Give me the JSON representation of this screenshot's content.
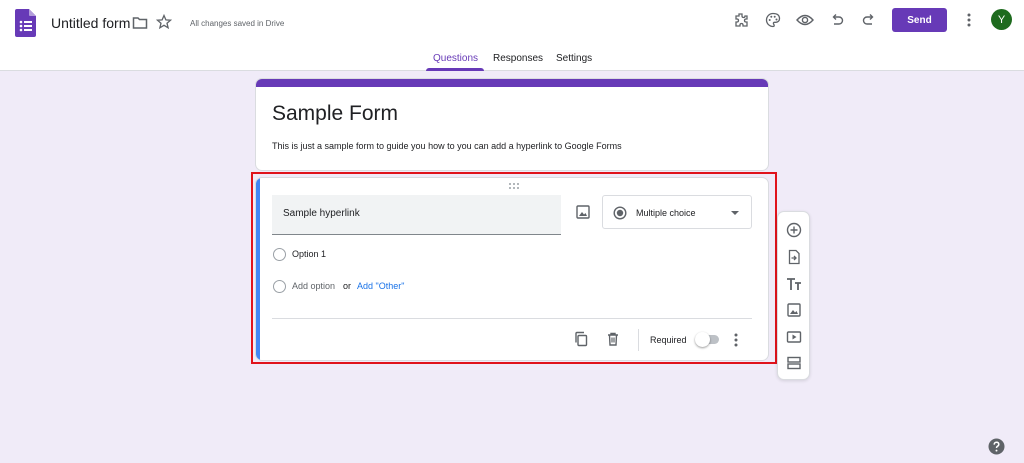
{
  "header": {
    "form_title": "Untitled form",
    "save_status": "All changes saved in Drive",
    "send_label": "Send",
    "avatar_initial": "Y"
  },
  "tabs": [
    {
      "label": "Questions",
      "active": true
    },
    {
      "label": "Responses",
      "active": false
    },
    {
      "label": "Settings",
      "active": false
    }
  ],
  "form": {
    "title": "Sample Form",
    "description": "This is just a sample form to guide you how to you can add a hyperlink to Google Forms"
  },
  "question": {
    "title": "Sample hyperlink",
    "type_label": "Multiple choice",
    "option_1": "Option 1",
    "add_option": "Add option",
    "or_text": "or",
    "add_other": "Add \"Other\"",
    "required_label": "Required",
    "required": false
  },
  "colors": {
    "brand": "#673ab7",
    "question_accent": "#4285f4",
    "highlight_outline": "#e0131c",
    "background": "#f0ebf8",
    "link": "#1a73e8"
  },
  "icons": {
    "header": [
      "forms-app-icon",
      "folder-icon",
      "star-icon",
      "addon-icon",
      "palette-icon",
      "preview-icon",
      "undo-icon",
      "redo-icon",
      "more-vert-icon"
    ],
    "side_toolbar": [
      "add-question-icon",
      "import-questions-icon",
      "add-title-icon",
      "add-image-icon",
      "add-video-icon",
      "add-section-icon"
    ]
  }
}
